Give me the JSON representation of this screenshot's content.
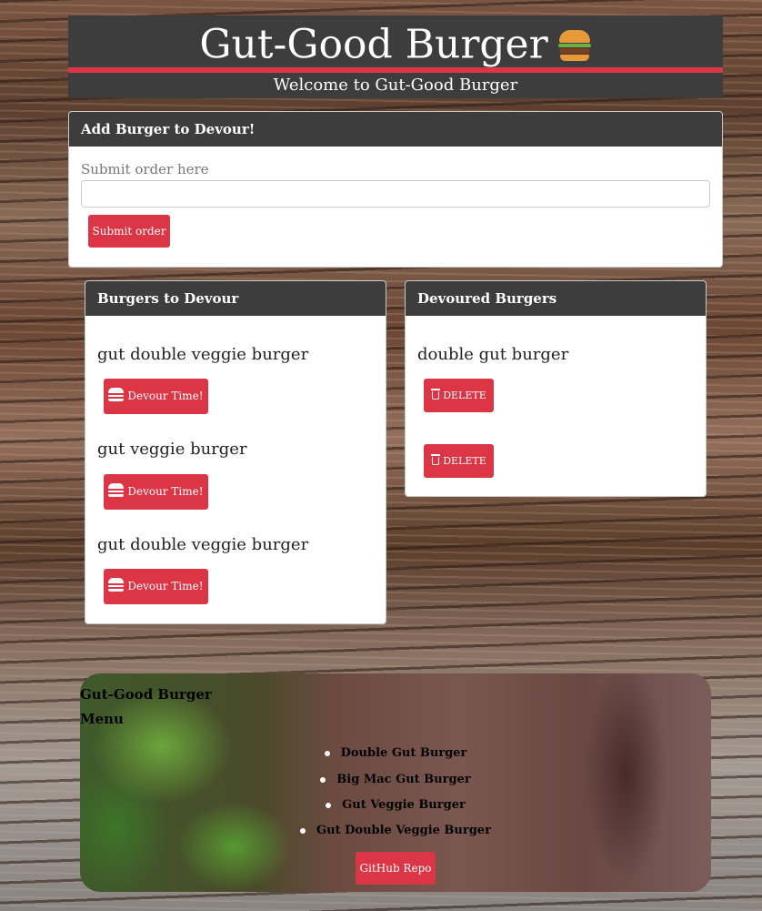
{
  "header": {
    "title": "Gut-Good Burger",
    "icon": "burger-icon",
    "subtitle": "Welcome to Gut-Good Burger"
  },
  "add_card": {
    "header": "Add Burger to Devour!",
    "label": "Submit order here",
    "input_value": "",
    "submit_label": "Submit order"
  },
  "devour_card": {
    "header": "Burgers to Devour",
    "items": [
      {
        "name": "gut double veggie burger",
        "button": "Devour Time!"
      },
      {
        "name": "gut veggie burger",
        "button": "Devour Time!"
      },
      {
        "name": "gut double veggie burger",
        "button": "Devour Time!"
      }
    ]
  },
  "devoured_card": {
    "header": "Devoured Burgers",
    "items": [
      {
        "name": "double gut burger",
        "button": "DELETE"
      },
      {
        "name": "",
        "button": "DELETE"
      }
    ]
  },
  "footer": {
    "title": "Gut-Good Burger",
    "menu_heading": "Menu",
    "menu_items": [
      "Double Gut Burger",
      "Big Mac Gut Burger",
      "Gut Veggie Burger",
      "Gut Double Veggie Burger"
    ],
    "github_label": "GitHub Repo"
  },
  "colors": {
    "accent": "#dc3545",
    "header_bg": "#3d3d3d"
  }
}
